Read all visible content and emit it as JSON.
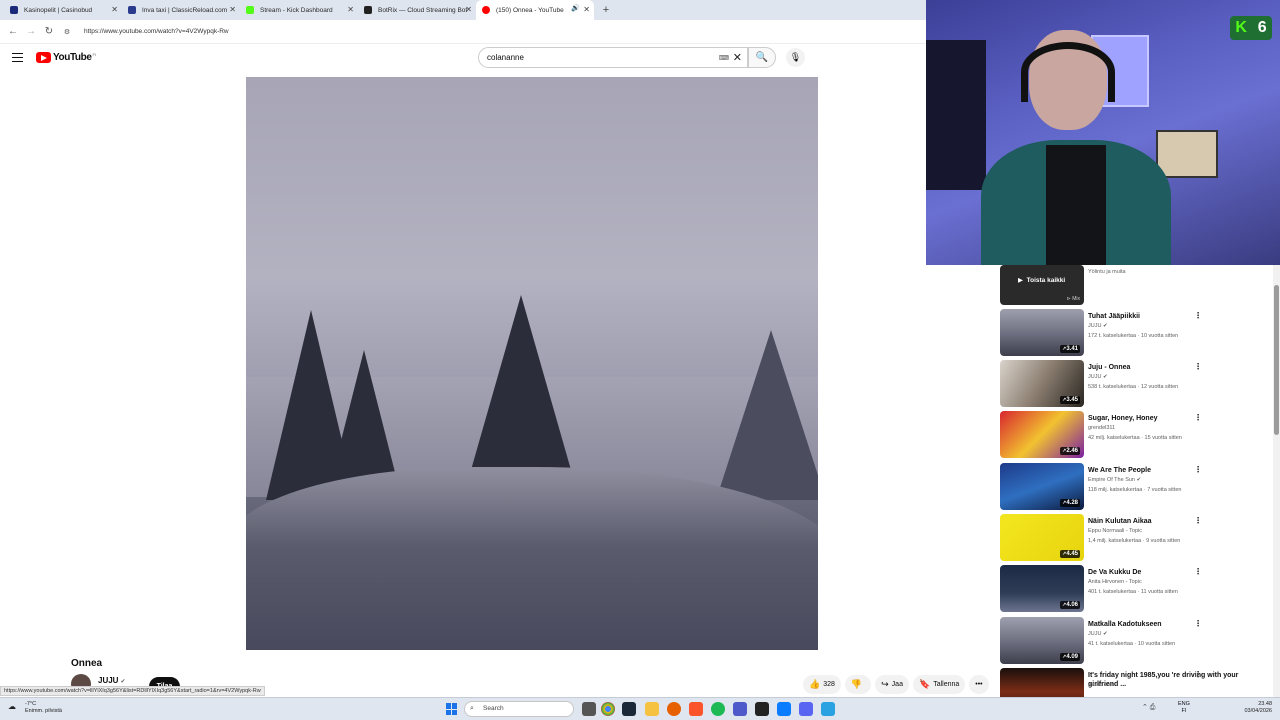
{
  "browser": {
    "tabs": [
      {
        "title": "Kasinopelit | Casinobud",
        "color": "#1b2a7a"
      },
      {
        "title": "Inva taxi | ClassicReload.com",
        "color": "#2b3c8f"
      },
      {
        "title": "Stream - Kick Dashboard",
        "color": "#53fc18"
      },
      {
        "title": "BotRix — Cloud Streaming Bot",
        "color": "#222222"
      },
      {
        "title": "(150) Onnea - YouTube",
        "color": "#ff0000"
      }
    ],
    "url": "https://www.youtube.com/watch?v=4V2Wypqk-Rw"
  },
  "youtube": {
    "logo_text": "YouTube",
    "logo_country": "FI",
    "search_value": "colananne",
    "video_title": "Onnea",
    "channel_name": "JUJU",
    "subscribe_label": "Tilaa",
    "likes": "328",
    "share_label": "Jaa",
    "save_label": "Tallenna",
    "status_url": "https://www.youtube.com/watch?v=lllYlXIq3g56Y&list=RDlllYlXIq3g56Y&start_radio=1&rv=4V2Wypqk-Rw"
  },
  "webcam": {
    "kick_count": "6"
  },
  "sidebar": {
    "partial": {
      "overlay_label": "Toista kaikki",
      "channel": "Yölintu ja muita",
      "mix": "Mix"
    },
    "items": [
      {
        "title": "Tuhat Jääpiikkii",
        "channel": "JUJU",
        "verified": true,
        "meta": "172 t. katselukertaa · 10 vuotta sitten",
        "duration": "3.41",
        "thumb": "linear-gradient(180deg,#9fa0ae,#6b6c7d 55%,#3e3f4c)"
      },
      {
        "title": "Juju - Onnea",
        "channel": "JUJU",
        "verified": true,
        "meta": "538 t. katselukertaa · 12 vuotta sitten",
        "duration": "3.45",
        "thumb": "linear-gradient(120deg,#d9d3cc,#8a7d6f 50%,#2a2622)"
      },
      {
        "title": "Sugar, Honey, Honey",
        "channel": "grendel311",
        "verified": false,
        "meta": "42 milj. katselukertaa · 15 vuotta sitten",
        "duration": "2.46",
        "thumb": "linear-gradient(135deg,#d8262f,#f2c230 50%,#7b1fa2)"
      },
      {
        "title": "We Are The People",
        "channel": "Empire Of The Sun",
        "verified": true,
        "meta": "118 milj. katselukertaa · 7 vuotta sitten",
        "duration": "4.28",
        "thumb": "linear-gradient(160deg,#1e3a8a,#2f6fc0 50%,#0c1a3d)"
      },
      {
        "title": "Näin Kulutan Aikaa",
        "channel": "Eppu Normaali - Topic",
        "verified": false,
        "meta": "1,4 milj. katselukertaa · 9 vuotta sitten",
        "duration": "4.45",
        "thumb": "linear-gradient(135deg,#f3e61f,#e7d40e)"
      },
      {
        "title": "De Va Kukku De",
        "channel": "Anita Hirvonen - Topic",
        "verified": false,
        "meta": "401 t. katselukertaa · 11 vuotta sitten",
        "duration": "4.06",
        "thumb": "linear-gradient(180deg,#1b2a44,#2f3d57 60%,#6d7590)"
      },
      {
        "title": "Matkalla Kadotukseen",
        "channel": "JUJU",
        "verified": true,
        "meta": "41 t. katselukertaa · 10 vuotta sitten",
        "duration": "4.09",
        "thumb": "linear-gradient(180deg,#9fa0ae,#6b6c7d 55%,#3e3f4c)"
      },
      {
        "title": "It's friday night 1985,you 're driving with your girlfriend ...",
        "channel": "music one",
        "verified": false,
        "meta": "",
        "duration": "",
        "thumb": "linear-gradient(180deg,#1a0f0c,#7a2d16 50%,#2b140c)"
      }
    ]
  },
  "taskbar": {
    "weather_temp": "-7°C",
    "weather_desc": "Enimm. pilvistä",
    "search_placeholder": "Search",
    "lang_top": "ENG",
    "lang_bottom": "FI",
    "time": "23.48",
    "date": "03/04/2026"
  }
}
